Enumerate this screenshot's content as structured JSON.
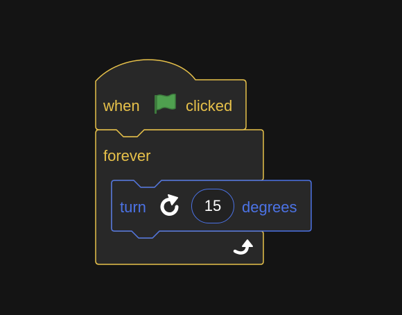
{
  "hat_block": {
    "label_when": "when",
    "label_clicked": "clicked",
    "icon": "green-flag-icon"
  },
  "forever_block": {
    "label": "forever",
    "loop_icon": "loop-arrow-icon"
  },
  "turn_block": {
    "label_turn": "turn",
    "direction_icon": "rotate-clockwise-icon",
    "degrees_value": "15",
    "label_degrees": "degrees"
  },
  "colors": {
    "background": "#141414",
    "block_fill": "#282828",
    "events_outline": "#e7c14a",
    "motion_outline": "#4c73e6",
    "flag_green": "#4fa04f"
  }
}
